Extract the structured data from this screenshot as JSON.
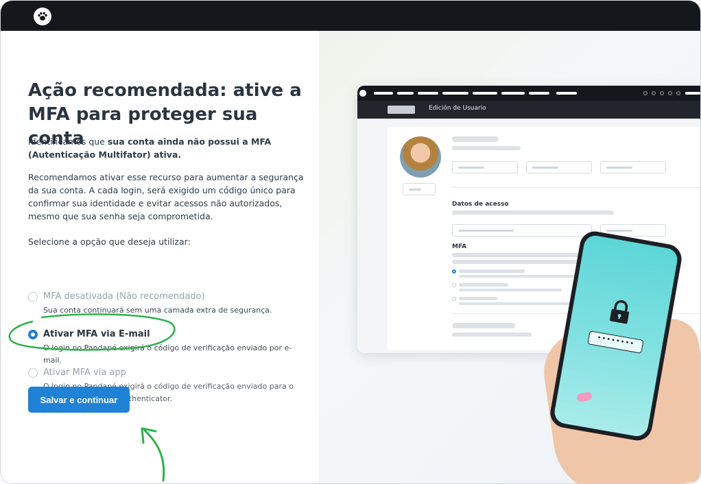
{
  "page": {
    "title": "Ação recomendada: ative a MFA para proteger sua conta",
    "intro_prefix": "Identificamos que ",
    "intro_bold": "sua conta ainda não possui a MFA (Autenticação Multifator) ativa.",
    "body": "Recomendamos ativar esse recurso para aumentar a segurança da sua conta. A cada login, será exigido um código único para confirmar sua identidade e evitar acessos não autorizados, mesmo que sua senha seja comprometida.",
    "select_prompt": "Selecione a opção que deseja utilizar:"
  },
  "options": [
    {
      "label": "MFA desativada (Não recomendado)",
      "desc": "Sua conta continuará sem uma camada extra de segurança.",
      "selected": false
    },
    {
      "label": "Ativar MFA via E-mail",
      "desc": "O login no Pandapé exigirá o código de verificação enviado por e-mail.",
      "selected": true
    },
    {
      "label": "Ativar MFA via app",
      "desc": "O login no Pandapé exigirá o código de verificação enviado para o aplicativo Microsoft Authenticator.",
      "selected": false
    }
  ],
  "actions": {
    "save_label": "Salvar e continuar"
  },
  "illustration": {
    "header_text": "Edición de Usuario",
    "section_access": "Datos de acesso",
    "section_mfa": "MFA",
    "password_mask": "••••••••"
  },
  "colors": {
    "accent": "#1f82d6",
    "annotation": "#2bb24c",
    "topbar": "#14171c"
  }
}
